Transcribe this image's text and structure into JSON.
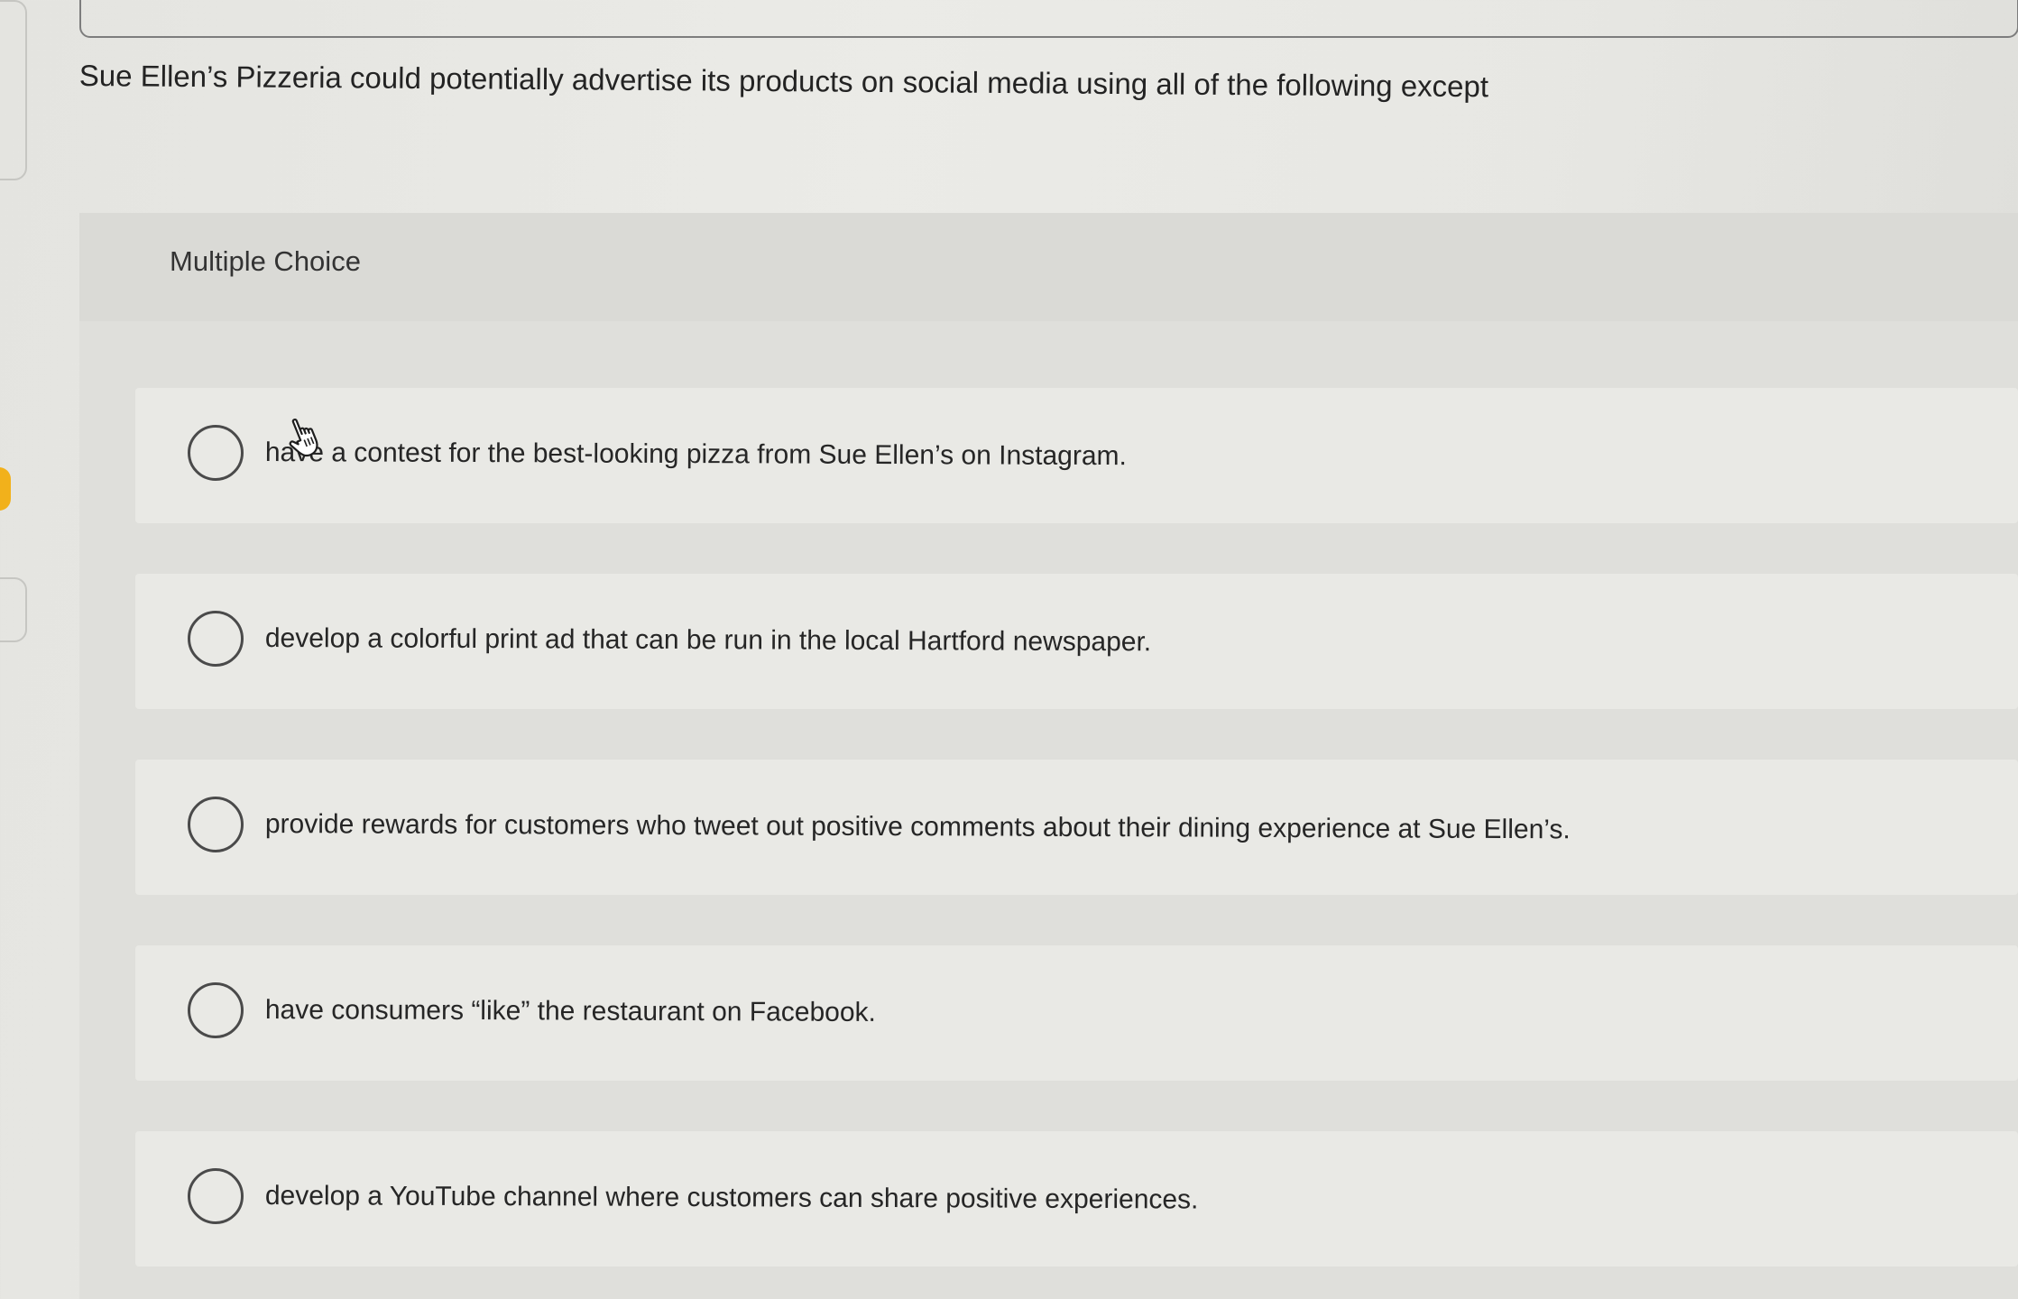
{
  "question": {
    "text": "Sue Ellen’s Pizzeria could potentially advertise its products on social media using all of the following except"
  },
  "multiple_choice": {
    "label": "Multiple Choice",
    "options": [
      {
        "text": "have a contest for the best-looking pizza from Sue Ellen’s on Instagram.",
        "selected": false
      },
      {
        "text": "develop a colorful print ad that can be run in the local Hartford newspaper.",
        "selected": false
      },
      {
        "text": "provide rewards for customers who tweet out positive comments about their dining experience at Sue Ellen’s.",
        "selected": false
      },
      {
        "text": "have consumers “like” the restaurant on Facebook.",
        "selected": false
      },
      {
        "text": "develop a YouTube channel where customers can share positive experiences.",
        "selected": false
      }
    ]
  },
  "cursor": {
    "icon": "hand-pointer-icon"
  },
  "colors": {
    "background": "#e6e6e2",
    "panel": "#dfdfdb",
    "option_row": "#e9e9e5",
    "text": "#262626",
    "radio_border": "#4a4a4a",
    "side_marker": "#f2b11b"
  }
}
